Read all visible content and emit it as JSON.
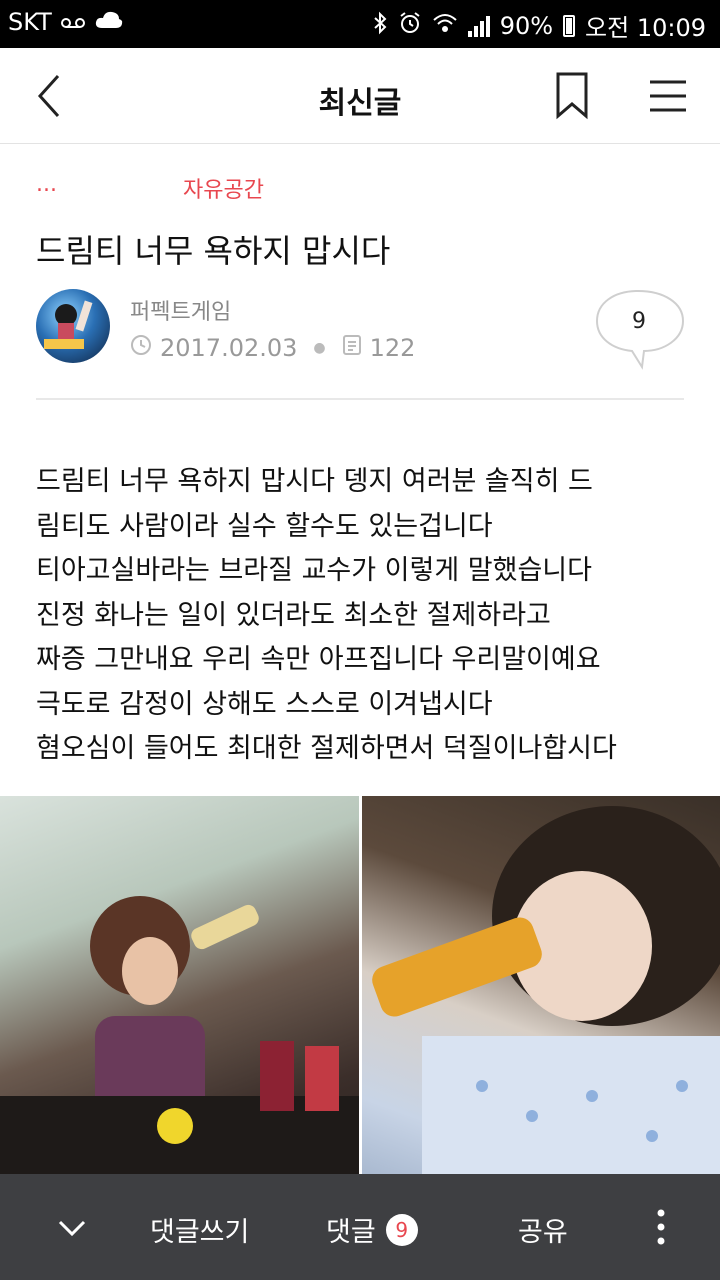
{
  "status_bar": {
    "carrier": "SKT",
    "battery": "90%",
    "time": "오전 10:09"
  },
  "header": {
    "title": "최신글",
    "back_icon": "back-arrow-icon",
    "bookmark_icon": "bookmark-icon",
    "menu_icon": "hamburger-menu-icon"
  },
  "post": {
    "breadcrumb_dots": "...",
    "board": "자유공간",
    "title": "드림티 너무 욕하지 맙시다",
    "author": "퍼펙트게임",
    "date": "2017.02.03",
    "views": "122",
    "comment_count": "9",
    "body_lines": [
      "드림티 너무 욕하지 맙시다 뎅지 여러분 솔직히 드",
      "림티도 사람이라 실수 할수도 있는겁니다",
      "티아고실바라는 브라질 교수가 이렇게 말했습니다",
      "진정 화나는 일이 있더라도 최소한 절제하라고",
      "짜증 그만내요 우리 속만 아프집니다 우리말이예요",
      "극도로 감정이 상해도 스스로 이겨냅시다",
      "혐오심이 들어도 최대한 절제하면서 덕질이나합시다"
    ]
  },
  "bottom_bar": {
    "write_label": "댓글쓰기",
    "comments_label": "댓글",
    "comments_badge": "9",
    "share_label": "공유"
  },
  "colors": {
    "accent": "#e8474f",
    "bottom_bar": "#3e3f42"
  }
}
